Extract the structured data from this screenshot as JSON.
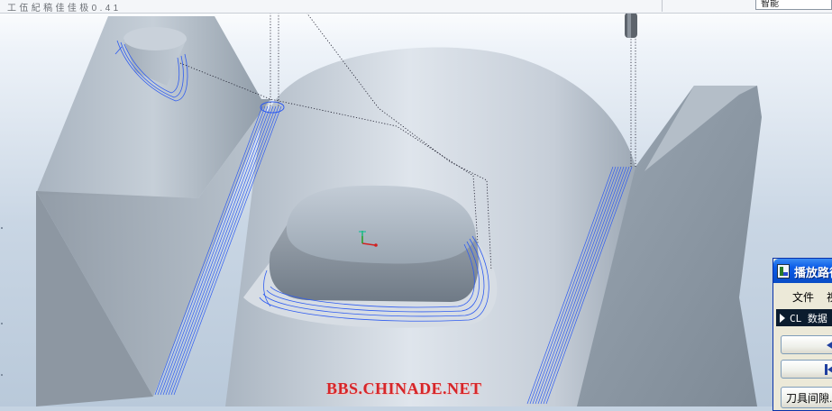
{
  "status_bar": {
    "left_text": "工 伍 紀 稿 佳 佳 极   0 . 4 1"
  },
  "top_right_field": {
    "value": "智能"
  },
  "watermark": {
    "text": "BBS.CHINADE.NET"
  },
  "viewport": {
    "toolpath_color": "#2f5cf0",
    "origin_axis_colors": {
      "x": "#d22020",
      "y": "#20a020",
      "z": "#2060e0"
    }
  },
  "playback_dialog": {
    "title": "播放路径",
    "menu": {
      "file": "文件",
      "view": "视图"
    },
    "cl_data_label": "CL 数据",
    "buttons": {
      "back_icon": "step-backward-icon",
      "first_icon": "skip-to-start-icon",
      "clearance_label": "刀具间隙..."
    }
  }
}
